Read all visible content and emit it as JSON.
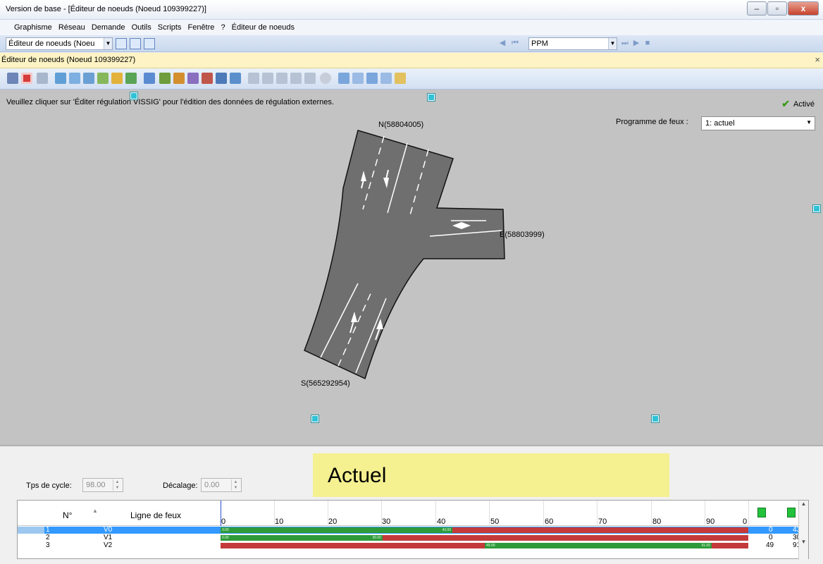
{
  "window": {
    "title": "Version de base  - [Éditeur de noeuds (Noeud 109399227)]"
  },
  "menu": [
    "Graphisme",
    "Réseau",
    "Demande",
    "Outils",
    "Scripts",
    "Fenêtre",
    "?",
    "Éditeur de noeuds"
  ],
  "toolbar": {
    "view_combo": "Éditeur de noeuds (Noeu",
    "ppm_combo": "PPM"
  },
  "subwindow": {
    "title": "Éditeur de noeuds (Noeud 109399227)",
    "close": "×"
  },
  "canvas": {
    "hint": "Veuillez cliquer sur 'Éditer régulation VISSIG' pour l'édition des données de régulation externes.",
    "active_label": "Activé",
    "program_label": "Programme de feux :",
    "program_value": "1: actuel",
    "node_north": "N(58804005)",
    "node_east": "E(58803999)",
    "node_south": "S(565292954)"
  },
  "bottom": {
    "cycle_label": "Tps de cycle:",
    "cycle_value": "98.00",
    "offset_label": "Décalage:",
    "offset_value": "0.00",
    "banner": "Actuel"
  },
  "grid": {
    "col_num": "N°",
    "col_line": "Ligne de feux",
    "ticks": [
      "0",
      "10",
      "20",
      "30",
      "40",
      "50",
      "60",
      "70",
      "80",
      "90",
      "0"
    ],
    "rows": [
      {
        "num": "1",
        "name": "V0",
        "start": "0",
        "end": "43",
        "g1": "0.00",
        "g2": "43.00"
      },
      {
        "num": "2",
        "name": "V1",
        "start": "0",
        "end": "30",
        "g1": "0.00",
        "g2": "30.00"
      },
      {
        "num": "3",
        "name": "V2",
        "start": "49",
        "end": "91",
        "g1": "49.00",
        "g2": "91.00"
      }
    ]
  }
}
